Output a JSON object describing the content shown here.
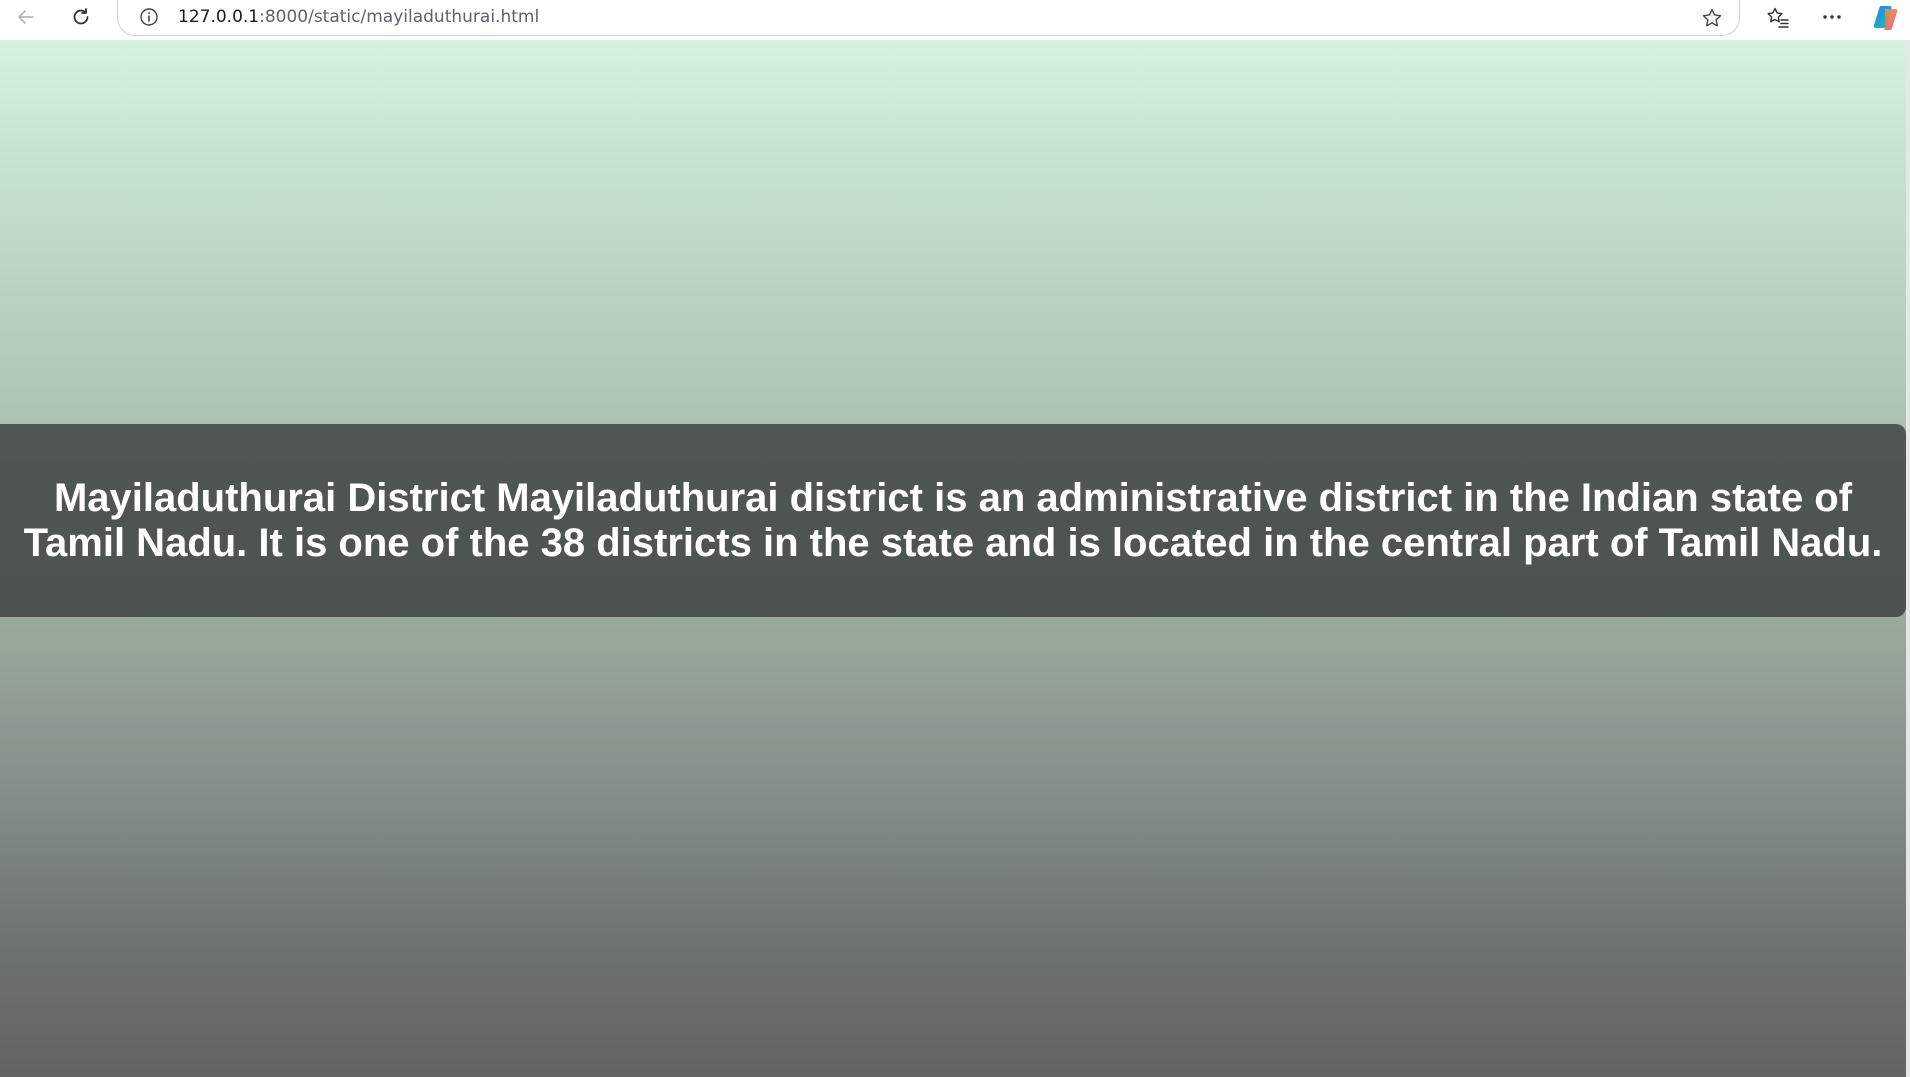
{
  "browser": {
    "url_host": "127.0.0.1",
    "url_path": ":8000/static/mayiladuthurai.html",
    "icons": {
      "back": "back-arrow-icon",
      "reload": "reload-icon",
      "info": "info-icon",
      "favorite": "star-icon",
      "favorites_list": "favorites-icon",
      "menu": "more-icon",
      "copilot": "copilot-icon"
    }
  },
  "page": {
    "banner_text": "Mayiladuthurai District Mayiladuthurai district is an administrative district in the Indian state of Tamil Nadu. It is one of the 38 districts in the state and is located in the central part of Tamil Nadu.",
    "colors": {
      "gradient_top": "#d6f2dd",
      "gradient_bottom": "#626562",
      "banner_bg": "#4a4f4b",
      "banner_text": "#ffffff"
    }
  }
}
